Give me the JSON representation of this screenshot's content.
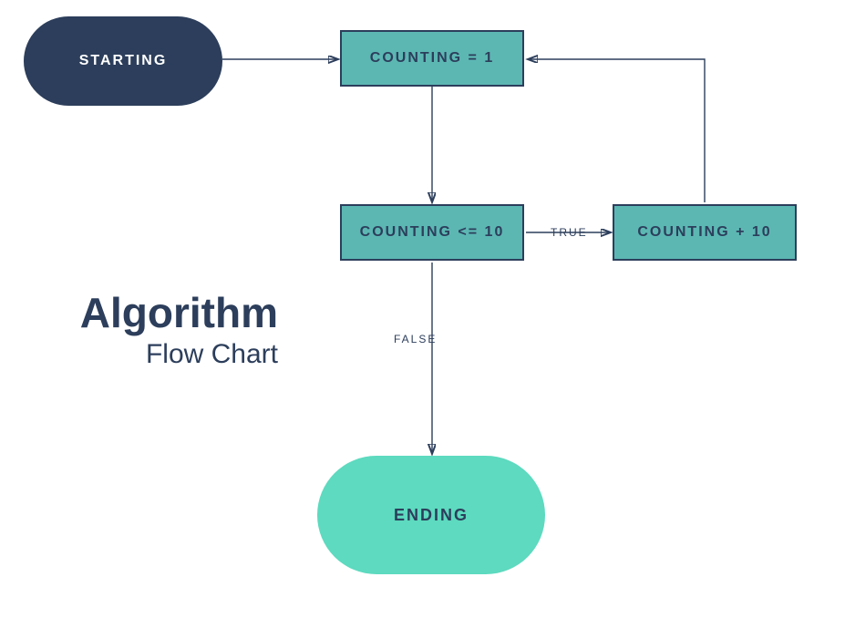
{
  "title": {
    "main": "Algorithm",
    "sub": "Flow Chart"
  },
  "nodes": {
    "starting": "STARTING",
    "counting1": "COUNTING = 1",
    "countingCond": "COUNTING <= 10",
    "countingPlus": "COUNTING + 10",
    "ending": "ENDING"
  },
  "edges": {
    "trueLabel": "TRUE",
    "falseLabel": "FALSE"
  },
  "colors": {
    "dark": "#2c3e5b",
    "teal": "#5cb7b3",
    "mint": "#5ddabf"
  }
}
